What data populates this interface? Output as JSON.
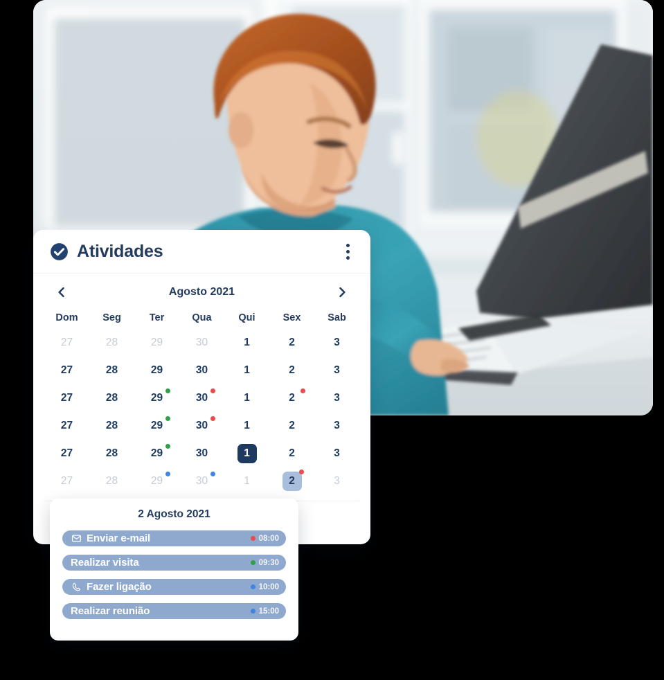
{
  "photo": {
    "alt": "man-at-laptop-photo",
    "description": "Man in teal sweater working on a laptop by a bright window"
  },
  "card": {
    "header": {
      "check_icon": "check-circle-icon",
      "title": "Atividades",
      "menu_icon": "kebab-menu-icon"
    },
    "calendar": {
      "prev_icon": "chevron-left-icon",
      "next_icon": "chevron-right-icon",
      "month_label": "Agosto 2021",
      "weekdays": [
        "Dom",
        "Seg",
        "Ter",
        "Qua",
        "Qui",
        "Sex",
        "Sab"
      ],
      "weeks": [
        [
          {
            "day": "27",
            "muted": true,
            "dot": null
          },
          {
            "day": "28",
            "muted": true,
            "dot": null
          },
          {
            "day": "29",
            "muted": true,
            "dot": null
          },
          {
            "day": "30",
            "muted": true,
            "dot": null
          },
          {
            "day": "1",
            "muted": false,
            "dot": null
          },
          {
            "day": "2",
            "muted": false,
            "dot": null
          },
          {
            "day": "3",
            "muted": false,
            "dot": null
          }
        ],
        [
          {
            "day": "27",
            "muted": false,
            "dot": null
          },
          {
            "day": "28",
            "muted": false,
            "dot": null
          },
          {
            "day": "29",
            "muted": false,
            "dot": null
          },
          {
            "day": "30",
            "muted": false,
            "dot": null
          },
          {
            "day": "1",
            "muted": false,
            "dot": null
          },
          {
            "day": "2",
            "muted": false,
            "dot": null
          },
          {
            "day": "3",
            "muted": false,
            "dot": null
          }
        ],
        [
          {
            "day": "27",
            "muted": false,
            "dot": null
          },
          {
            "day": "28",
            "muted": false,
            "dot": null
          },
          {
            "day": "29",
            "muted": false,
            "dot": "green"
          },
          {
            "day": "30",
            "muted": false,
            "dot": "red"
          },
          {
            "day": "1",
            "muted": false,
            "dot": null
          },
          {
            "day": "2",
            "muted": false,
            "dot": "red"
          },
          {
            "day": "3",
            "muted": false,
            "dot": null
          }
        ],
        [
          {
            "day": "27",
            "muted": false,
            "dot": null
          },
          {
            "day": "28",
            "muted": false,
            "dot": null
          },
          {
            "day": "29",
            "muted": false,
            "dot": "green"
          },
          {
            "day": "30",
            "muted": false,
            "dot": "red"
          },
          {
            "day": "1",
            "muted": false,
            "dot": null
          },
          {
            "day": "2",
            "muted": false,
            "dot": null
          },
          {
            "day": "3",
            "muted": false,
            "dot": null
          }
        ],
        [
          {
            "day": "27",
            "muted": false,
            "dot": null
          },
          {
            "day": "28",
            "muted": false,
            "dot": null
          },
          {
            "day": "29",
            "muted": false,
            "dot": "green"
          },
          {
            "day": "30",
            "muted": false,
            "dot": null
          },
          {
            "day": "1",
            "muted": false,
            "dot": null,
            "state": "today"
          },
          {
            "day": "2",
            "muted": false,
            "dot": null
          },
          {
            "day": "3",
            "muted": false,
            "dot": null
          }
        ],
        [
          {
            "day": "27",
            "muted": true,
            "dot": null
          },
          {
            "day": "28",
            "muted": true,
            "dot": null
          },
          {
            "day": "29",
            "muted": true,
            "dot": "blue"
          },
          {
            "day": "30",
            "muted": true,
            "dot": "blue"
          },
          {
            "day": "1",
            "muted": true,
            "dot": null
          },
          {
            "day": "2",
            "muted": false,
            "dot": "red",
            "state": "selected"
          },
          {
            "day": "3",
            "muted": true,
            "dot": null
          }
        ]
      ]
    }
  },
  "popup": {
    "date_label": "2 Agosto 2021",
    "activities": [
      {
        "icon": "envelope-icon",
        "label": "Enviar e-mail",
        "time": "08:00",
        "dot_color": "#ea4b4b"
      },
      {
        "icon": null,
        "label": "Realizar visita",
        "time": "09:30",
        "dot_color": "#2fa14b"
      },
      {
        "icon": "phone-icon",
        "label": "Fazer ligação",
        "time": "10:00",
        "dot_color": "#3f86e0"
      },
      {
        "icon": null,
        "label": "Realizar reunião",
        "time": "15:00",
        "dot_color": "#3f86e0"
      }
    ]
  },
  "colors": {
    "navy": "#243b5e",
    "activity_bar": "#8fa9ce",
    "selected_day_bg": "#a9bedd",
    "today_bg": "#1f3a60",
    "red": "#ea4b4b",
    "green": "#2fa14b",
    "blue": "#3f86e0"
  }
}
